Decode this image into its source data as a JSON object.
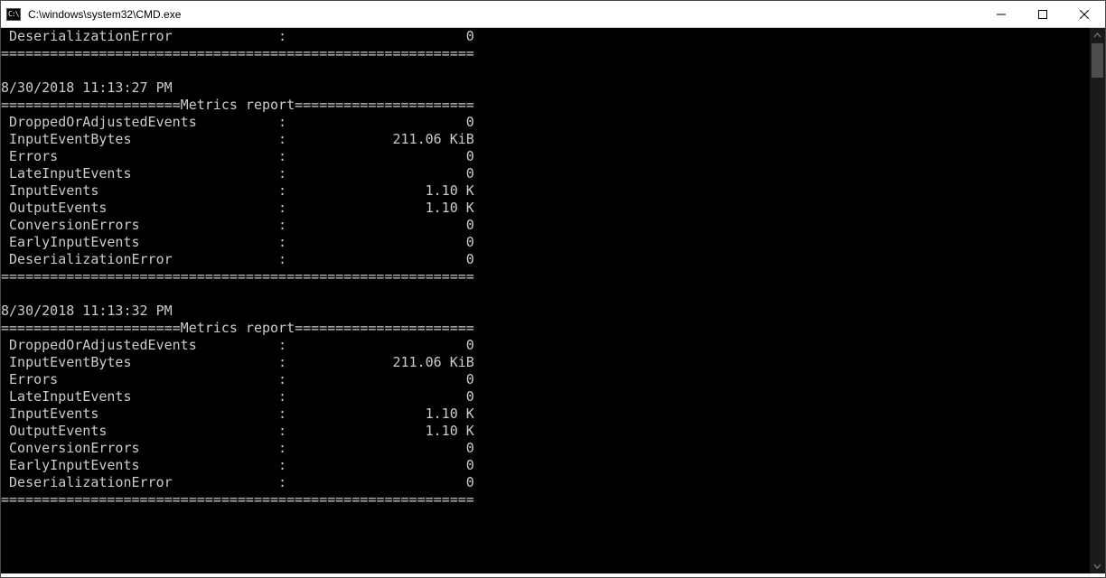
{
  "window": {
    "title": "C:\\windows\\system32\\CMD.exe",
    "cmd_icon_text": "C:\\."
  },
  "separator_line": "==========================================================",
  "metrics_header_label": "Metrics report",
  "metric_key_col_width": 33,
  "metric_val_col_width": 23,
  "previous_last_metric": {
    "key": "DeserializationError",
    "value": "0"
  },
  "reports": [
    {
      "timestamp": "8/30/2018 11:13:27 PM",
      "metrics": [
        {
          "key": "DroppedOrAdjustedEvents",
          "value": "0"
        },
        {
          "key": "InputEventBytes",
          "value": "211.06 KiB"
        },
        {
          "key": "Errors",
          "value": "0"
        },
        {
          "key": "LateInputEvents",
          "value": "0"
        },
        {
          "key": "InputEvents",
          "value": "1.10 K"
        },
        {
          "key": "OutputEvents",
          "value": "1.10 K"
        },
        {
          "key": "ConversionErrors",
          "value": "0"
        },
        {
          "key": "EarlyInputEvents",
          "value": "0"
        },
        {
          "key": "DeserializationError",
          "value": "0"
        }
      ]
    },
    {
      "timestamp": "8/30/2018 11:13:32 PM",
      "metrics": [
        {
          "key": "DroppedOrAdjustedEvents",
          "value": "0"
        },
        {
          "key": "InputEventBytes",
          "value": "211.06 KiB"
        },
        {
          "key": "Errors",
          "value": "0"
        },
        {
          "key": "LateInputEvents",
          "value": "0"
        },
        {
          "key": "InputEvents",
          "value": "1.10 K"
        },
        {
          "key": "OutputEvents",
          "value": "1.10 K"
        },
        {
          "key": "ConversionErrors",
          "value": "0"
        },
        {
          "key": "EarlyInputEvents",
          "value": "0"
        },
        {
          "key": "DeserializationError",
          "value": "0"
        }
      ]
    }
  ]
}
